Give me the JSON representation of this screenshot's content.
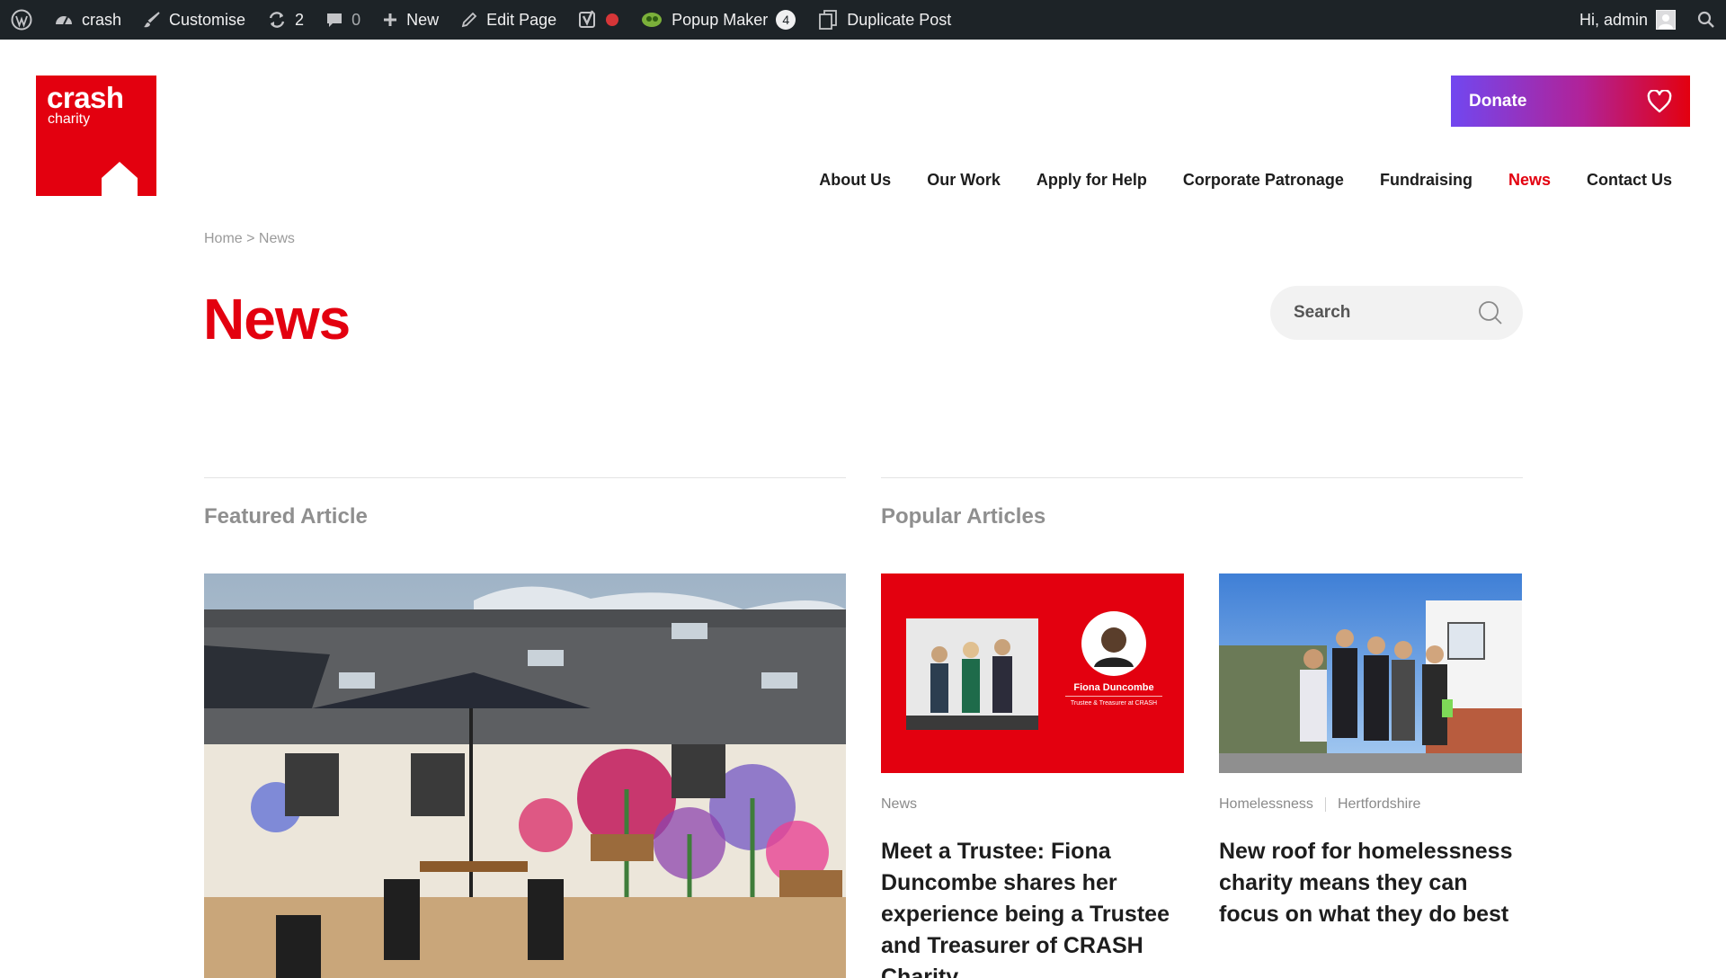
{
  "admin_bar": {
    "site_name": "crash",
    "customise": "Customise",
    "updates_count": "2",
    "comments_count": "0",
    "new_label": "New",
    "edit_page": "Edit Page",
    "popup_maker": "Popup Maker",
    "popup_maker_count": "4",
    "duplicate_post": "Duplicate Post",
    "greeting": "Hi, admin"
  },
  "logo": {
    "line1": "crash",
    "line2": "charity"
  },
  "donate_label": "Donate",
  "nav": {
    "items": [
      {
        "label": "About Us"
      },
      {
        "label": "Our Work"
      },
      {
        "label": "Apply for Help"
      },
      {
        "label": "Corporate Patronage"
      },
      {
        "label": "Fundraising"
      },
      {
        "label": "News"
      },
      {
        "label": "Contact Us"
      }
    ],
    "active": "News"
  },
  "breadcrumb": "Home > News",
  "page_title": "News",
  "search": {
    "placeholder": "Search"
  },
  "sections": {
    "featured": "Featured Article",
    "popular": "Popular Articles"
  },
  "trustee_graphic": {
    "name": "Fiona Duncombe",
    "role": "Trustee & Treasurer at CRASH"
  },
  "popular_articles": [
    {
      "tags": [
        "News"
      ],
      "title": "Meet a Trustee: Fiona Duncombe shares her experience being a Trustee and Treasurer of CRASH Charity"
    },
    {
      "tags": [
        "Homelessness",
        "Hertfordshire"
      ],
      "title": "New roof for homelessness charity means they can focus on what they do best"
    }
  ],
  "colors": {
    "brand_red": "#e3000f",
    "admin_bar": "#1d2327",
    "donate_start": "#7147f0"
  }
}
